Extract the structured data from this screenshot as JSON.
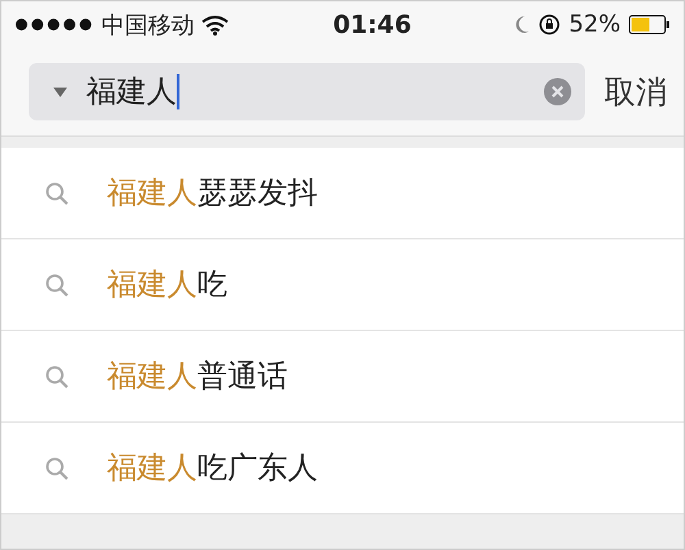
{
  "status_bar": {
    "carrier": "中国移动",
    "time": "01:46",
    "battery": "52%"
  },
  "search": {
    "value": "福建人",
    "cancel": "取消"
  },
  "suggestions": [
    {
      "match": "福建人",
      "rest": "瑟瑟发抖"
    },
    {
      "match": "福建人",
      "rest": "吃"
    },
    {
      "match": "福建人",
      "rest": "普通话"
    },
    {
      "match": "福建人",
      "rest": "吃广东人"
    }
  ]
}
